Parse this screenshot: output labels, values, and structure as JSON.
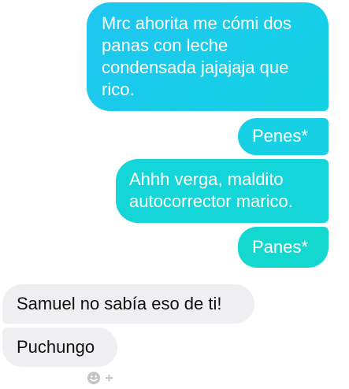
{
  "messages": [
    {
      "direction": "sent",
      "lines": [
        "Mrc ahorita me cómi dos",
        "panas con leche",
        "condensada jajajaja que",
        "rico."
      ]
    },
    {
      "direction": "sent",
      "text": "Penes*"
    },
    {
      "direction": "sent",
      "lines": [
        "Ahhh verga, maldito",
        "autocorrector marico."
      ]
    },
    {
      "direction": "sent",
      "text": "Panes*"
    },
    {
      "direction": "received",
      "text": "Samuel no sabía eso de ti!"
    },
    {
      "direction": "received",
      "text": "Puchungo"
    }
  ],
  "reaction_button": {
    "icon": "add-reaction-icon"
  },
  "colors": {
    "sent_gradient_start": "#1ec6f0",
    "sent_gradient_end": "#12d8cf",
    "received_bubble": "#efeff2",
    "received_text": "#111111",
    "reaction_icon": "#c4c4c8"
  }
}
